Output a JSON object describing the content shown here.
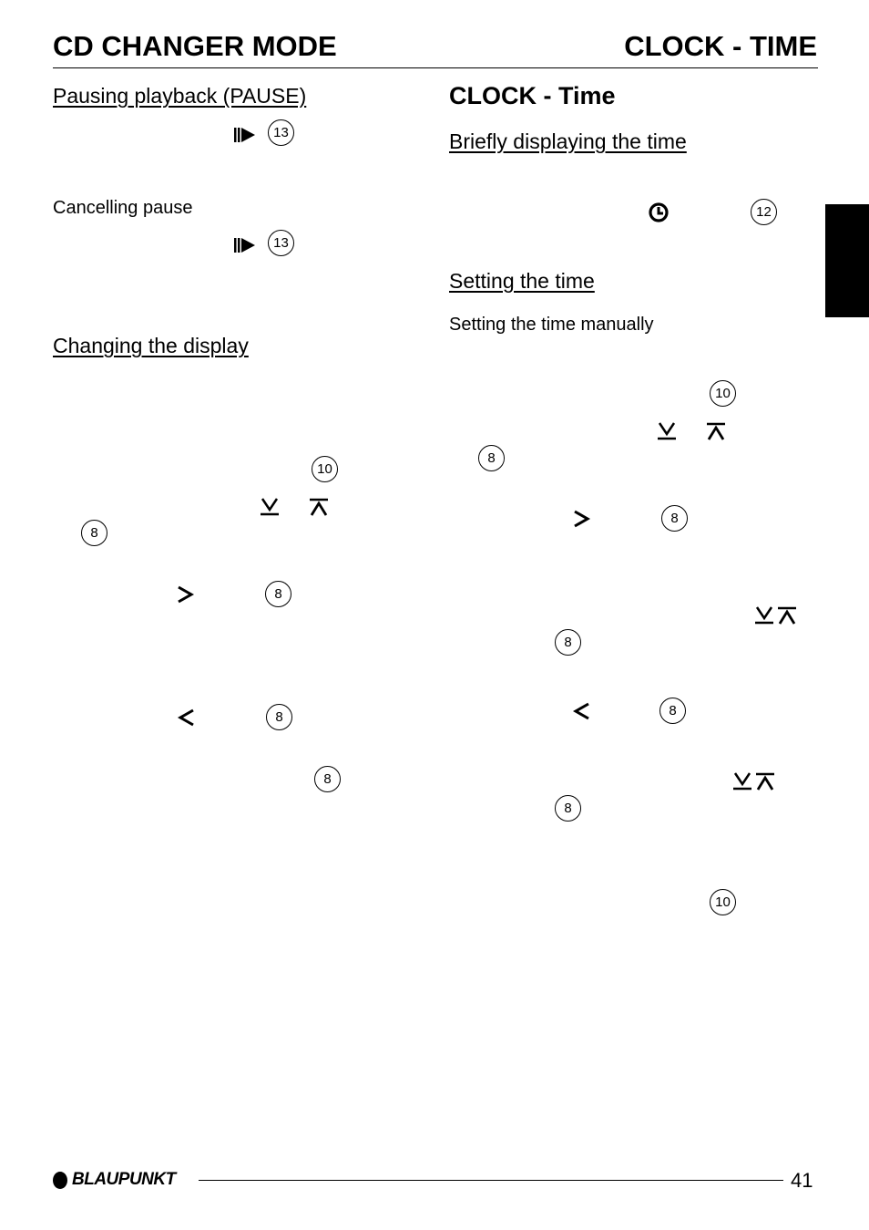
{
  "header": {
    "left_title": "CD CHANGER MODE",
    "right_title": "CLOCK - TIME"
  },
  "left_column": {
    "pause_heading": "Pausing playback (PAUSE)",
    "pause_symbol": "play-pause-icon",
    "pause_button_number": "13",
    "cancel_pause_heading": "Cancelling pause",
    "cancel_symbol": "play-pause-icon",
    "cancel_button_number": "13",
    "display_heading": "Changing the display",
    "display_callouts": {
      "button_10": "10",
      "button_8_a": "8",
      "button_8_right": "8",
      "button_8_left": "8",
      "button_8_b": "8"
    }
  },
  "right_column": {
    "section_heading": "CLOCK - Time",
    "brief_heading": "Briefly displaying the time",
    "brief_button_number": "12",
    "setting_heading": "Setting the time",
    "manual_heading": "Setting the time manually",
    "callouts": {
      "button_10_a": "10",
      "button_8_a": "8",
      "button_8_right": "8",
      "button_8_b": "8",
      "button_8_left": "8",
      "button_8_c": "8",
      "button_10_b": "10"
    }
  },
  "footer": {
    "brand": "BLAUPUNKT",
    "page_number": "41"
  }
}
